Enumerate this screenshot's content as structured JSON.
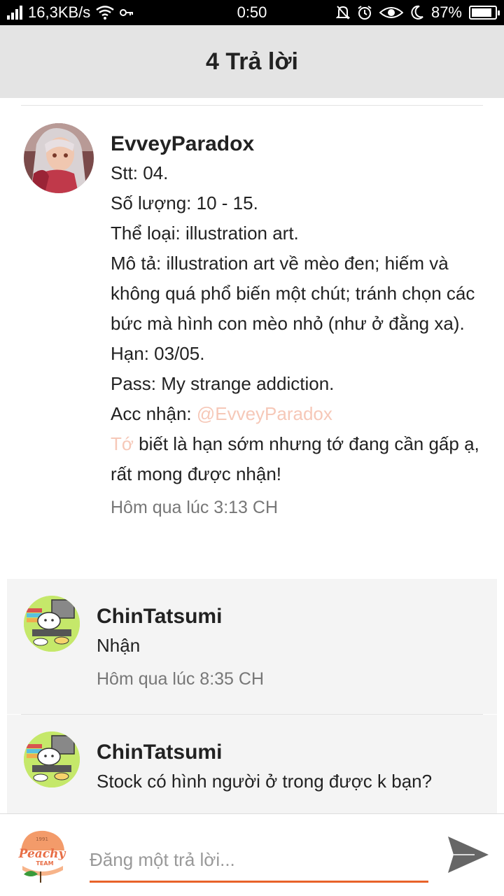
{
  "status_bar": {
    "network_speed": "16,3KB/s",
    "time": "0:50",
    "battery": "87%",
    "battery_level": 0.87
  },
  "header": {
    "title": "4 Trả lời"
  },
  "post": {
    "author": "EvveyParadox",
    "lines": [
      "Stt: 04.",
      "Số lượng: 10 - 15.",
      "Thể loại: illustration art.",
      "Mô tả: illustration art về mèo đen; hiếm và không quá phổ biến một chút; tránh chọn các bức mà hình con mèo nhỏ (như ở đằng xa).",
      "Hạn: 03/05.",
      "Pass: My strange addiction."
    ],
    "acc_label": "Acc nhận: ",
    "acc_mention": "@EvveyParadox",
    "note_mention": "Tớ",
    "note_text": " biết là hạn sớm nhưng tớ đang cần gấp ạ, rất mong được nhận!",
    "time": "Hôm qua lúc 3:13 CH"
  },
  "replies": [
    {
      "author": "ChinTatsumi",
      "text": "Nhận",
      "time": "Hôm qua lúc 8:35 CH"
    },
    {
      "author": "ChinTatsumi",
      "text": "Stock có hình người ở trong được k bạn?",
      "time": ""
    }
  ],
  "composer": {
    "placeholder": "Đăng một trả lời...",
    "logo_year": "1991",
    "logo_brand": "Peachy",
    "logo_team": "TEAM"
  },
  "colors": {
    "accent": "#e8632a",
    "mention": "#f6c8b8",
    "header_bg": "#e4e4e4",
    "reply_bg": "#f4f4f4"
  },
  "icons": {
    "send": "send-icon",
    "wifi": "wifi-icon",
    "key": "key-icon",
    "mute": "bell-off-icon",
    "alarm": "alarm-icon",
    "eye": "eye-icon",
    "moon": "moon-icon",
    "battery": "battery-icon"
  }
}
